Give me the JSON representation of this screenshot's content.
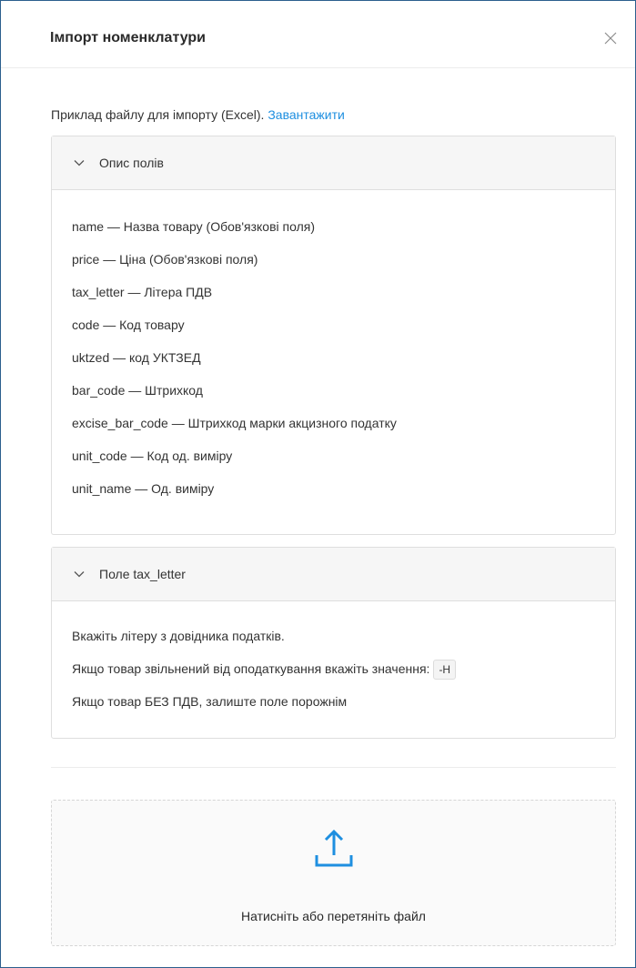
{
  "modal": {
    "title": "Імпорт номенклатури",
    "close_icon": "close-icon"
  },
  "sample": {
    "text": "Приклад файлу для імпорту (Excel).",
    "link": "Завантажити"
  },
  "fields_panel": {
    "title": "Опис полів",
    "expanded": true,
    "items": [
      "name — Назва товару (Обов'язкові поля)",
      "price — Ціна (Обов'язкові поля)",
      "tax_letter — Літера ПДВ",
      "code — Код товару",
      "uktzed — код УКТЗЕД",
      "bar_code — Штрихкод",
      "excise_bar_code — Штрихкод марки акцизного податку",
      "unit_code — Код од. виміру",
      "unit_name — Од. виміру"
    ]
  },
  "tax_panel": {
    "title": "Поле tax_letter",
    "expanded": true,
    "line1": "Вкажіть літеру з довідника податків.",
    "line2": "Якщо товар звільнений від оподаткування вкажіть значення:",
    "code": "-Н",
    "line3": "Якщо товар БЕЗ ПДВ, залиште поле порожнім"
  },
  "dropzone": {
    "icon": "upload-icon",
    "text": "Натисніть або перетяніть файл"
  },
  "colors": {
    "accent": "#1e8fe0",
    "border": "#2b5f8e"
  }
}
